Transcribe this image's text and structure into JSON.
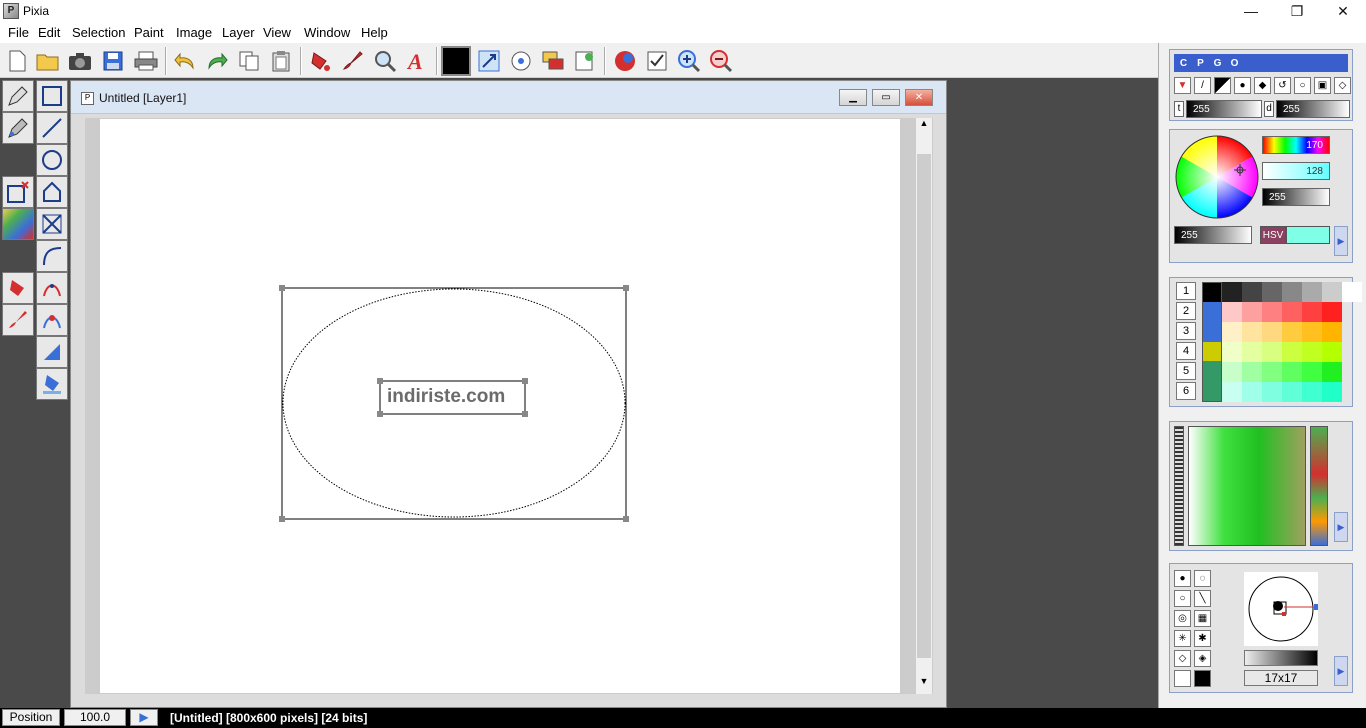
{
  "app": {
    "title": "Pixia",
    "icon": "pixia-app-icon"
  },
  "window_controls": {
    "minimize": "—",
    "maximize": "❐",
    "close": "✕"
  },
  "menu": [
    {
      "label": "File"
    },
    {
      "label": "Edit"
    },
    {
      "label": "Selection"
    },
    {
      "label": "Paint"
    },
    {
      "label": "Image"
    },
    {
      "label": "Layer"
    },
    {
      "label": "View"
    },
    {
      "label": "Window"
    },
    {
      "label": "Help"
    }
  ],
  "document": {
    "title": "Untitled [Layer1]",
    "watermark_text": "indiriste.com"
  },
  "status": {
    "position_button": "Position",
    "zoom_value": "100.0",
    "info": "[Untitled] [800x600 pixels] [24 bits]"
  },
  "color_panel": {
    "tabs": [
      "C",
      "P",
      "G",
      "O"
    ],
    "t_label": "t",
    "t_value": "255",
    "d_label": "d",
    "d_value": "255",
    "hue_value": "170",
    "sat_value": "128",
    "val_value": "255",
    "alpha_value": "255",
    "mode_label": "HSV"
  },
  "palette": {
    "row_labels": [
      "1",
      "2",
      "3",
      "4",
      "5",
      "6"
    ],
    "colors": [
      [
        "#000000",
        "#222222",
        "#444444",
        "#666666",
        "#888888",
        "#aaaaaa",
        "#cccccc",
        "#ffffff"
      ],
      [
        "#ffc8c8",
        "#ffa0a0",
        "#ff8080",
        "#ff6060",
        "#ff4040",
        "#ff2020"
      ],
      [
        "#fff0c8",
        "#ffe4a0",
        "#ffd880",
        "#ffcc40",
        "#ffc020",
        "#ffb400"
      ],
      [
        "#f0ffc8",
        "#e4ffa0",
        "#d8ff80",
        "#ccff40",
        "#c0ff20",
        "#b4ff00"
      ],
      [
        "#c8ffc8",
        "#a0ffa0",
        "#80ff80",
        "#60ff60",
        "#40ff40",
        "#20f020"
      ],
      [
        "#c8fff0",
        "#a0ffe8",
        "#80ffe0",
        "#60ffd8",
        "#40ffd0",
        "#20ffc8"
      ]
    ]
  },
  "brush": {
    "size_label": "17x17"
  },
  "colors": {
    "workspace": "#4a4a4a",
    "accent": "#3a5fcd",
    "doc_title_bg": "#dbe6f4"
  }
}
